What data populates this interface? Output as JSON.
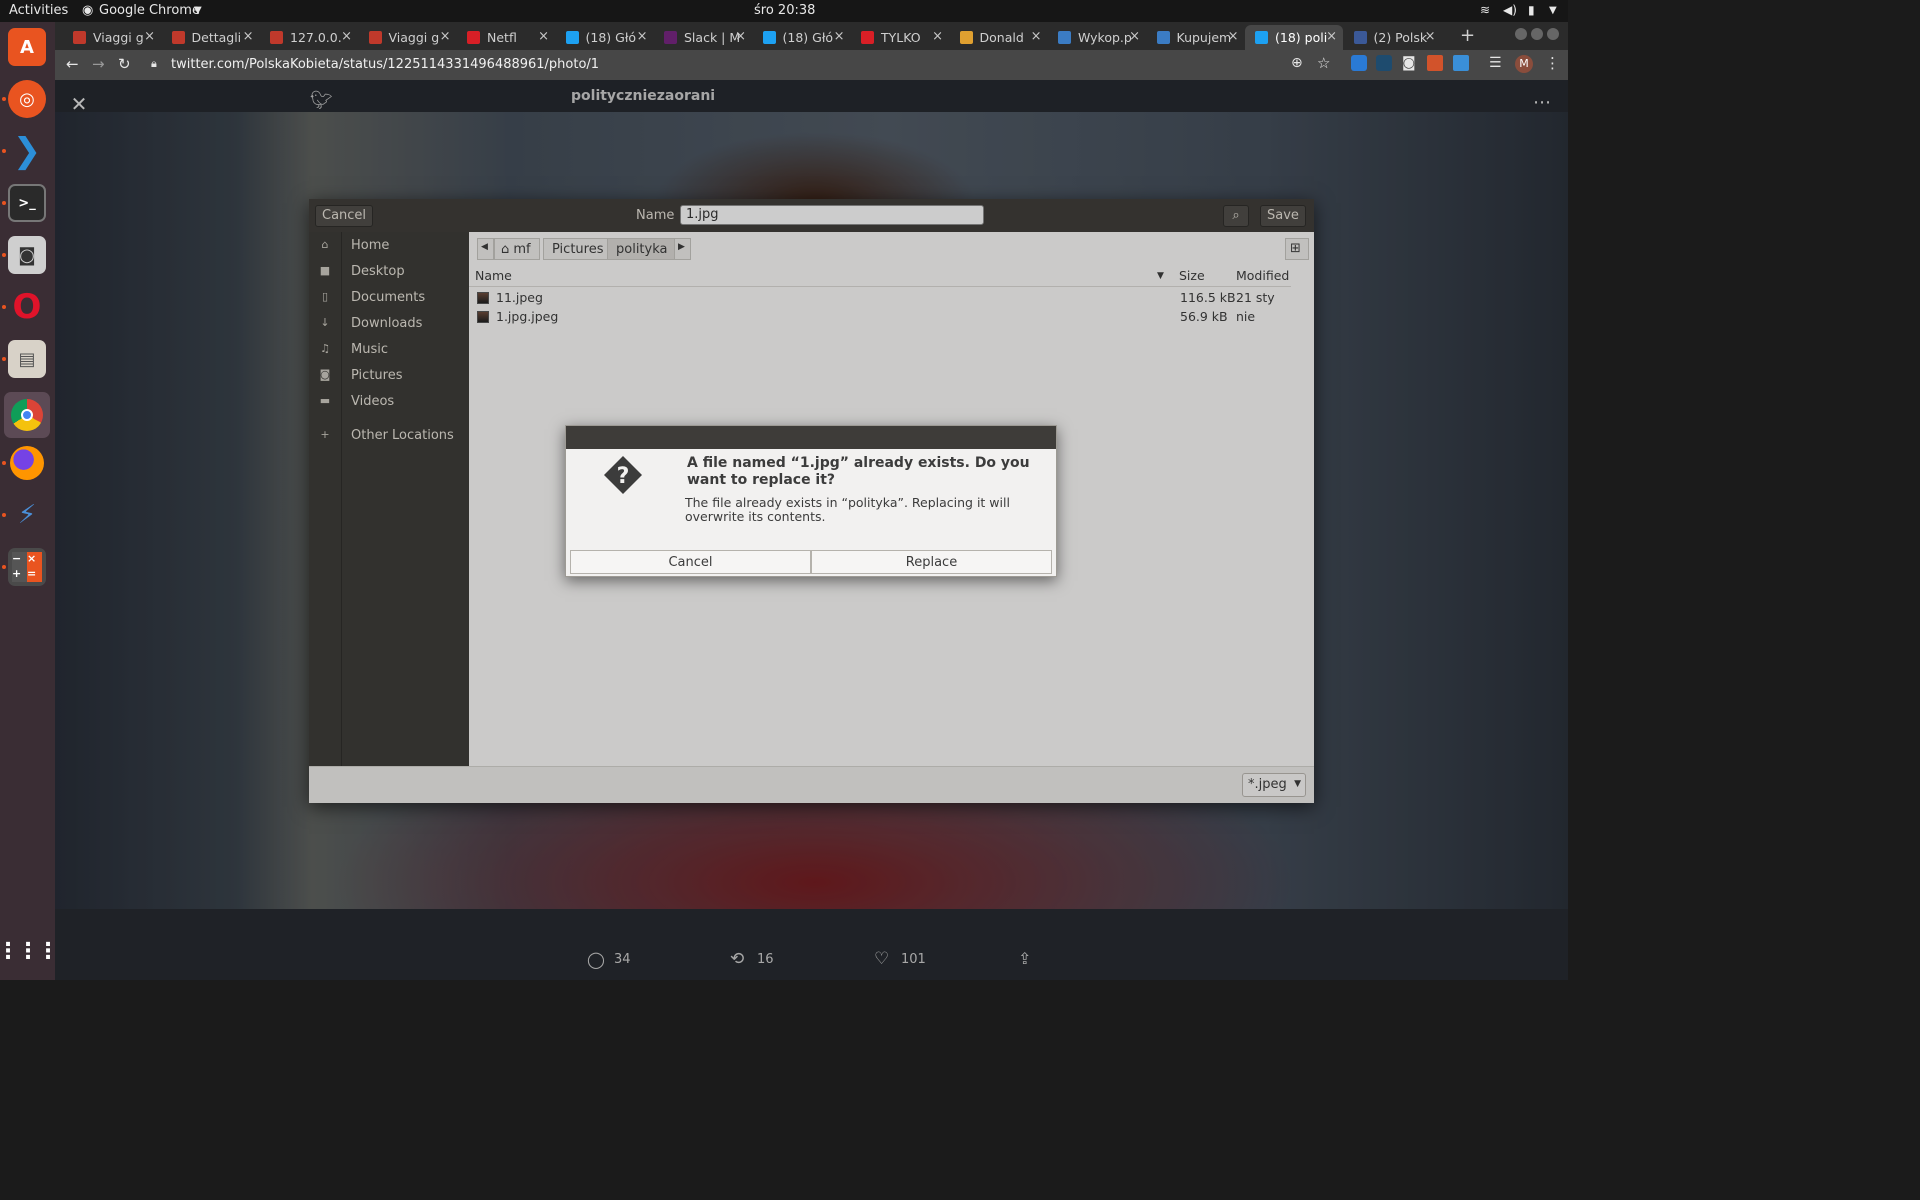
{
  "topbar": {
    "activities": "Activities",
    "app": "Google Chrome",
    "clock": "śro 20:38"
  },
  "tabs": [
    {
      "label": "Viaggi g",
      "fav_color": "#c0392b"
    },
    {
      "label": "Dettagli",
      "fav_color": "#c0392b"
    },
    {
      "label": "127.0.0.",
      "fav_color": "#c0392b"
    },
    {
      "label": "Viaggi g",
      "fav_color": "#c0392b"
    },
    {
      "label": "Netfl",
      "fav_color": "#d81f26"
    },
    {
      "label": "(18) Głó",
      "fav_color": "#1da1f2"
    },
    {
      "label": "Slack | M",
      "fav_color": "#611f69"
    },
    {
      "label": "(18) Głó",
      "fav_color": "#1da1f2"
    },
    {
      "label": "TYLKO",
      "fav_color": "#d81f26"
    },
    {
      "label": "Donald",
      "fav_color": "#e0a030"
    },
    {
      "label": "Wykop.p",
      "fav_color": "#3b7cc4"
    },
    {
      "label": "Kupujem",
      "fav_color": "#3b7cc4"
    },
    {
      "label": "(18) poli",
      "fav_color": "#1da1f2"
    },
    {
      "label": "(2) Polsk",
      "fav_color": "#3b5998"
    }
  ],
  "url": "twitter.com/PolskaKobieta/status/1225114331496488961/photo/1",
  "profile_initial": "M",
  "tweet": {
    "header": "polityczniezaorani",
    "replies": "34",
    "retweets": "16",
    "likes": "101"
  },
  "filechooser": {
    "cancel": "Cancel",
    "name_label": "Name",
    "filename": "1.jpg",
    "save": "Save",
    "sidebar": [
      {
        "label": "Home",
        "icon": "home-icon",
        "glyph": "⌂"
      },
      {
        "label": "Desktop",
        "icon": "folder-icon",
        "glyph": "■"
      },
      {
        "label": "Documents",
        "icon": "document-icon",
        "glyph": "▯"
      },
      {
        "label": "Downloads",
        "icon": "download-icon",
        "glyph": "↓"
      },
      {
        "label": "Music",
        "icon": "music-icon",
        "glyph": "♫"
      },
      {
        "label": "Pictures",
        "icon": "camera-icon",
        "glyph": "◙"
      },
      {
        "label": "Videos",
        "icon": "video-icon",
        "glyph": "▬"
      },
      {
        "label": "Other Locations",
        "icon": "plus-icon",
        "glyph": "+"
      }
    ],
    "breadcrumbs": [
      "mf",
      "Pictures",
      "polityka"
    ],
    "columns": {
      "name": "Name",
      "size": "Size",
      "modified": "Modified"
    },
    "files": [
      {
        "name": "11.jpeg",
        "size": "116.5 kB",
        "modified": "21 sty"
      },
      {
        "name": "1.jpg.jpeg",
        "size": "56.9 kB",
        "modified": "nie"
      }
    ],
    "filter": "*.jpeg"
  },
  "confirm": {
    "title": "A file named “1.jpg” already exists.  Do you want to replace it?",
    "message": "The file already exists in “polityka”.  Replacing it will overwrite its contents.",
    "cancel": "Cancel",
    "replace": "Replace"
  }
}
